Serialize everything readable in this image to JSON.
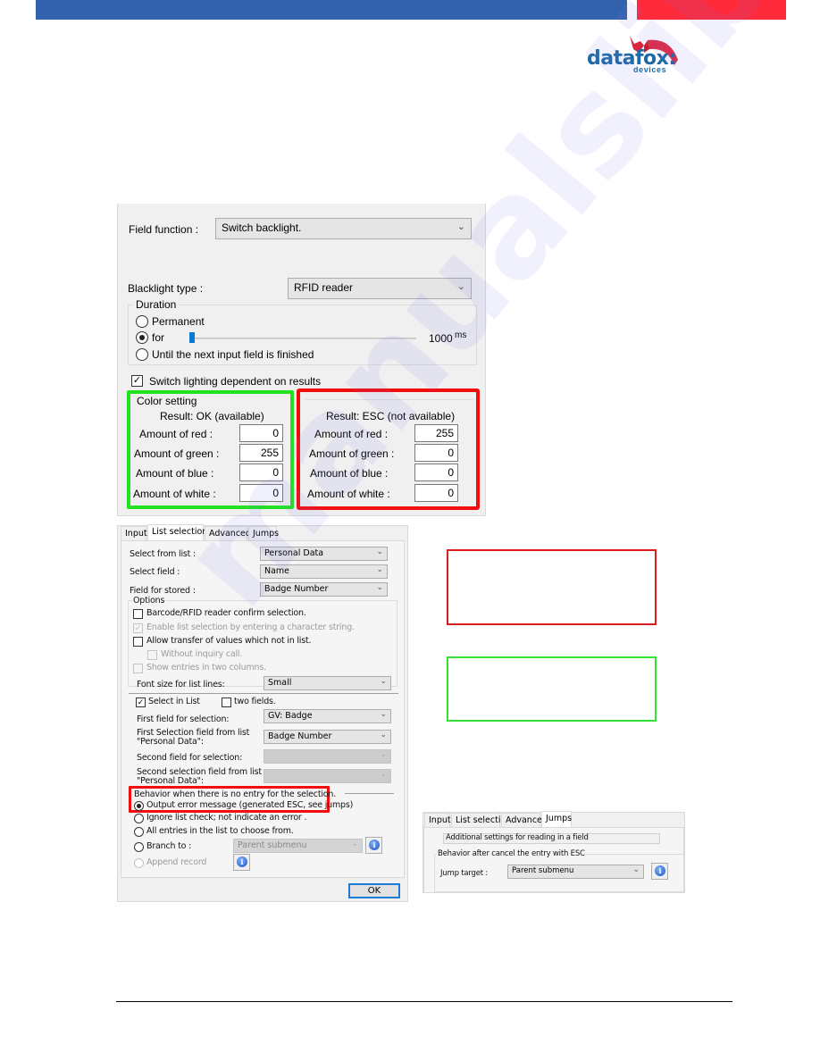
{
  "header": {
    "bar_left_color": "#3262ad",
    "bar_right_color": "#ff2a3a",
    "logo": {
      "word_a": "data",
      "word_b": "fox:",
      "sub": "devices",
      "icon": "fox-head-icon"
    }
  },
  "backlight_dialog": {
    "field_function_label": "Field function :",
    "field_function_value": "Switch backlight.",
    "backlight_type_label": "Blacklight type :",
    "backlight_type_value": "RFID reader",
    "duration": {
      "title": "Duration",
      "options": [
        "Permanent",
        "for",
        "Until the next input field is finished"
      ],
      "selected": "for",
      "slider_value_ms": 1000,
      "slider_readout": "1000",
      "slider_unit": "ms"
    },
    "switch_lighting_label": "Switch lighting dependent on results",
    "switch_lighting_checked": true,
    "color_setting": {
      "title": "Color setting",
      "ok": {
        "heading": "Result: OK (available)",
        "rows": [
          {
            "label": "Amount of red :",
            "value": "0"
          },
          {
            "label": "Amount of green :",
            "value": "255"
          },
          {
            "label": "Amount of blue :",
            "value": "0"
          },
          {
            "label": "Amount of white :",
            "value": "0"
          }
        ]
      },
      "esc": {
        "heading": "Result: ESC (not available)",
        "rows": [
          {
            "label": "Amount of red :",
            "value": "255"
          },
          {
            "label": "Amount of green :",
            "value": "0"
          },
          {
            "label": "Amount of blue :",
            "value": "0"
          },
          {
            "label": "Amount of white :",
            "value": "0"
          }
        ]
      }
    },
    "highlight_ok_color": "#22e21f",
    "highlight_esc_color": "#f40c0c"
  },
  "list_dialog": {
    "tabs": [
      "Input",
      "List selection",
      "Advanced",
      "Jumps"
    ],
    "active_tab": "List selection",
    "select_from_list_label": "Select from list :",
    "select_from_list_value": "Personal Data",
    "select_field_label": "Select field :",
    "select_field_value": "Name",
    "field_for_stored_label": "Field for stored :",
    "field_for_stored_value": "Badge Number",
    "options": {
      "title": "Options",
      "barcode_confirm": {
        "label": "Barcode/RFID reader confirm selection.",
        "checked": false
      },
      "enable_list_selection": {
        "label": "Enable list selection by entering a character string.",
        "checked": true,
        "disabled": true
      },
      "allow_transfer": {
        "label": "Allow transfer of values which not in list.",
        "checked": false
      },
      "without_inquiry": {
        "label": "Without inquiry call.",
        "checked": false,
        "disabled": true
      },
      "show_two_columns": {
        "label": "Show entries in two columns.",
        "checked": false,
        "disabled": true
      },
      "font_size_label": "Font size for list lines:",
      "font_size_value": "Small"
    },
    "select_in_list": {
      "label": "Select in List",
      "checked": true
    },
    "two_fields": {
      "label": "two fields.",
      "checked": false
    },
    "first_field_label": "First field for selection:",
    "first_field_value": "GV: Badge",
    "first_selection_label_1": "First Selection field from list",
    "first_selection_label_2": "\"Personal Data\":",
    "first_selection_value": "Badge Number",
    "second_field_label": "Second field for selection:",
    "second_selection_label_1": "Second selection field from list",
    "second_selection_label_2": "\"Personal Data\":",
    "behavior": {
      "title": "Behavior when there is no entry for the selection.",
      "options": [
        "Output error message (generated ESC, see jumps)",
        "Ignore list check; not indicate an error .",
        "All entries in the list to choose from.",
        "Branch to :",
        "Append record"
      ],
      "selected": "Output error message (generated ESC, see jumps)",
      "branch_value": "Parent submenu"
    },
    "ok_label": "OK"
  },
  "jumps_dialog": {
    "tabs": [
      "Input",
      "List selection",
      "Advanced",
      "Jumps"
    ],
    "active_tab": "Jumps",
    "info_text": "Additional settings for reading in a field",
    "group_title": "Behavior after cancel the entry with ESC",
    "jump_target_label": "Jump target :",
    "jump_target_value": "Parent submenu"
  },
  "annotation_boxes": {
    "red_color": "#d81e1e",
    "green_color": "#33e035"
  },
  "watermark": "manualslib"
}
